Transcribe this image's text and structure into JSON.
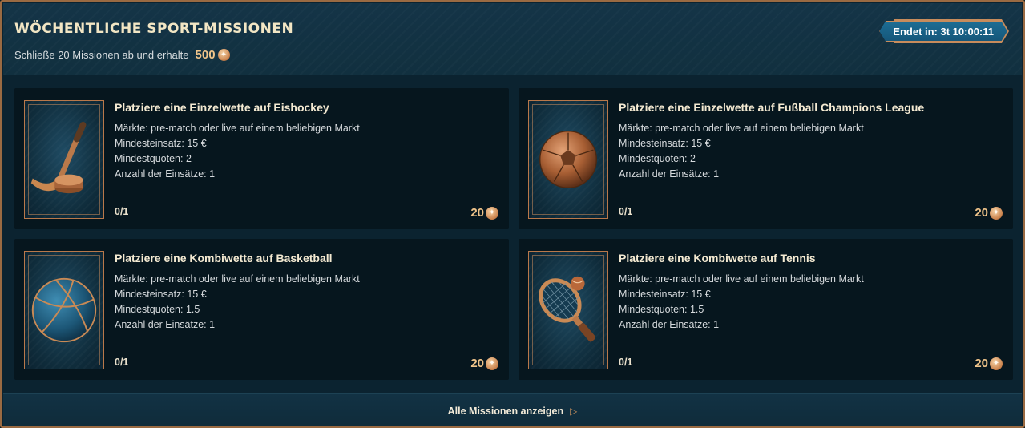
{
  "header": {
    "title": "Wöchentliche Sport-Missionen",
    "subtitle": "Schließe 20 Missionen ab und erhalte",
    "reward_total": "500",
    "timer_label": "Endet in: 3t 10:00:11"
  },
  "missions": [
    {
      "title": "Platziere eine Einzelwette auf Eishockey",
      "lines": [
        "Märkte: pre-match oder live auf einem beliebigen Markt",
        "Mindesteinsatz: 15 €",
        "Mindestquoten: 2",
        "Anzahl der Einsätze: 1"
      ],
      "progress": "0/1",
      "reward": "20",
      "icon": "hockey-stick-icon"
    },
    {
      "title": "Platziere eine Einzelwette auf Fußball Champions League",
      "lines": [
        "Märkte: pre-match oder live auf einem beliebigen Markt",
        "Mindesteinsatz: 15 €",
        "Mindestquoten: 2",
        "Anzahl der Einsätze: 1"
      ],
      "progress": "0/1",
      "reward": "20",
      "icon": "soccer-ball-icon"
    },
    {
      "title": "Platziere eine Kombiwette auf Basketball",
      "lines": [
        "Märkte: pre-match oder live auf einem beliebigen Markt",
        "Mindesteinsatz: 15 €",
        "Mindestquoten: 1.5",
        "Anzahl der Einsätze: 1"
      ],
      "progress": "0/1",
      "reward": "20",
      "icon": "basketball-icon"
    },
    {
      "title": "Platziere eine Kombiwette auf Tennis",
      "lines": [
        "Märkte: pre-match oder live auf einem beliebigen Markt",
        "Mindesteinsatz: 15 €",
        "Mindestquoten: 1.5",
        "Anzahl der Einsätze: 1"
      ],
      "progress": "0/1",
      "reward": "20",
      "icon": "tennis-racket-icon"
    }
  ],
  "footer": {
    "link_label": "Alle Missionen anzeigen"
  },
  "colors": {
    "accent": "#f0c48a",
    "border": "#b9784a",
    "timer_bg": "#1d6d94"
  }
}
